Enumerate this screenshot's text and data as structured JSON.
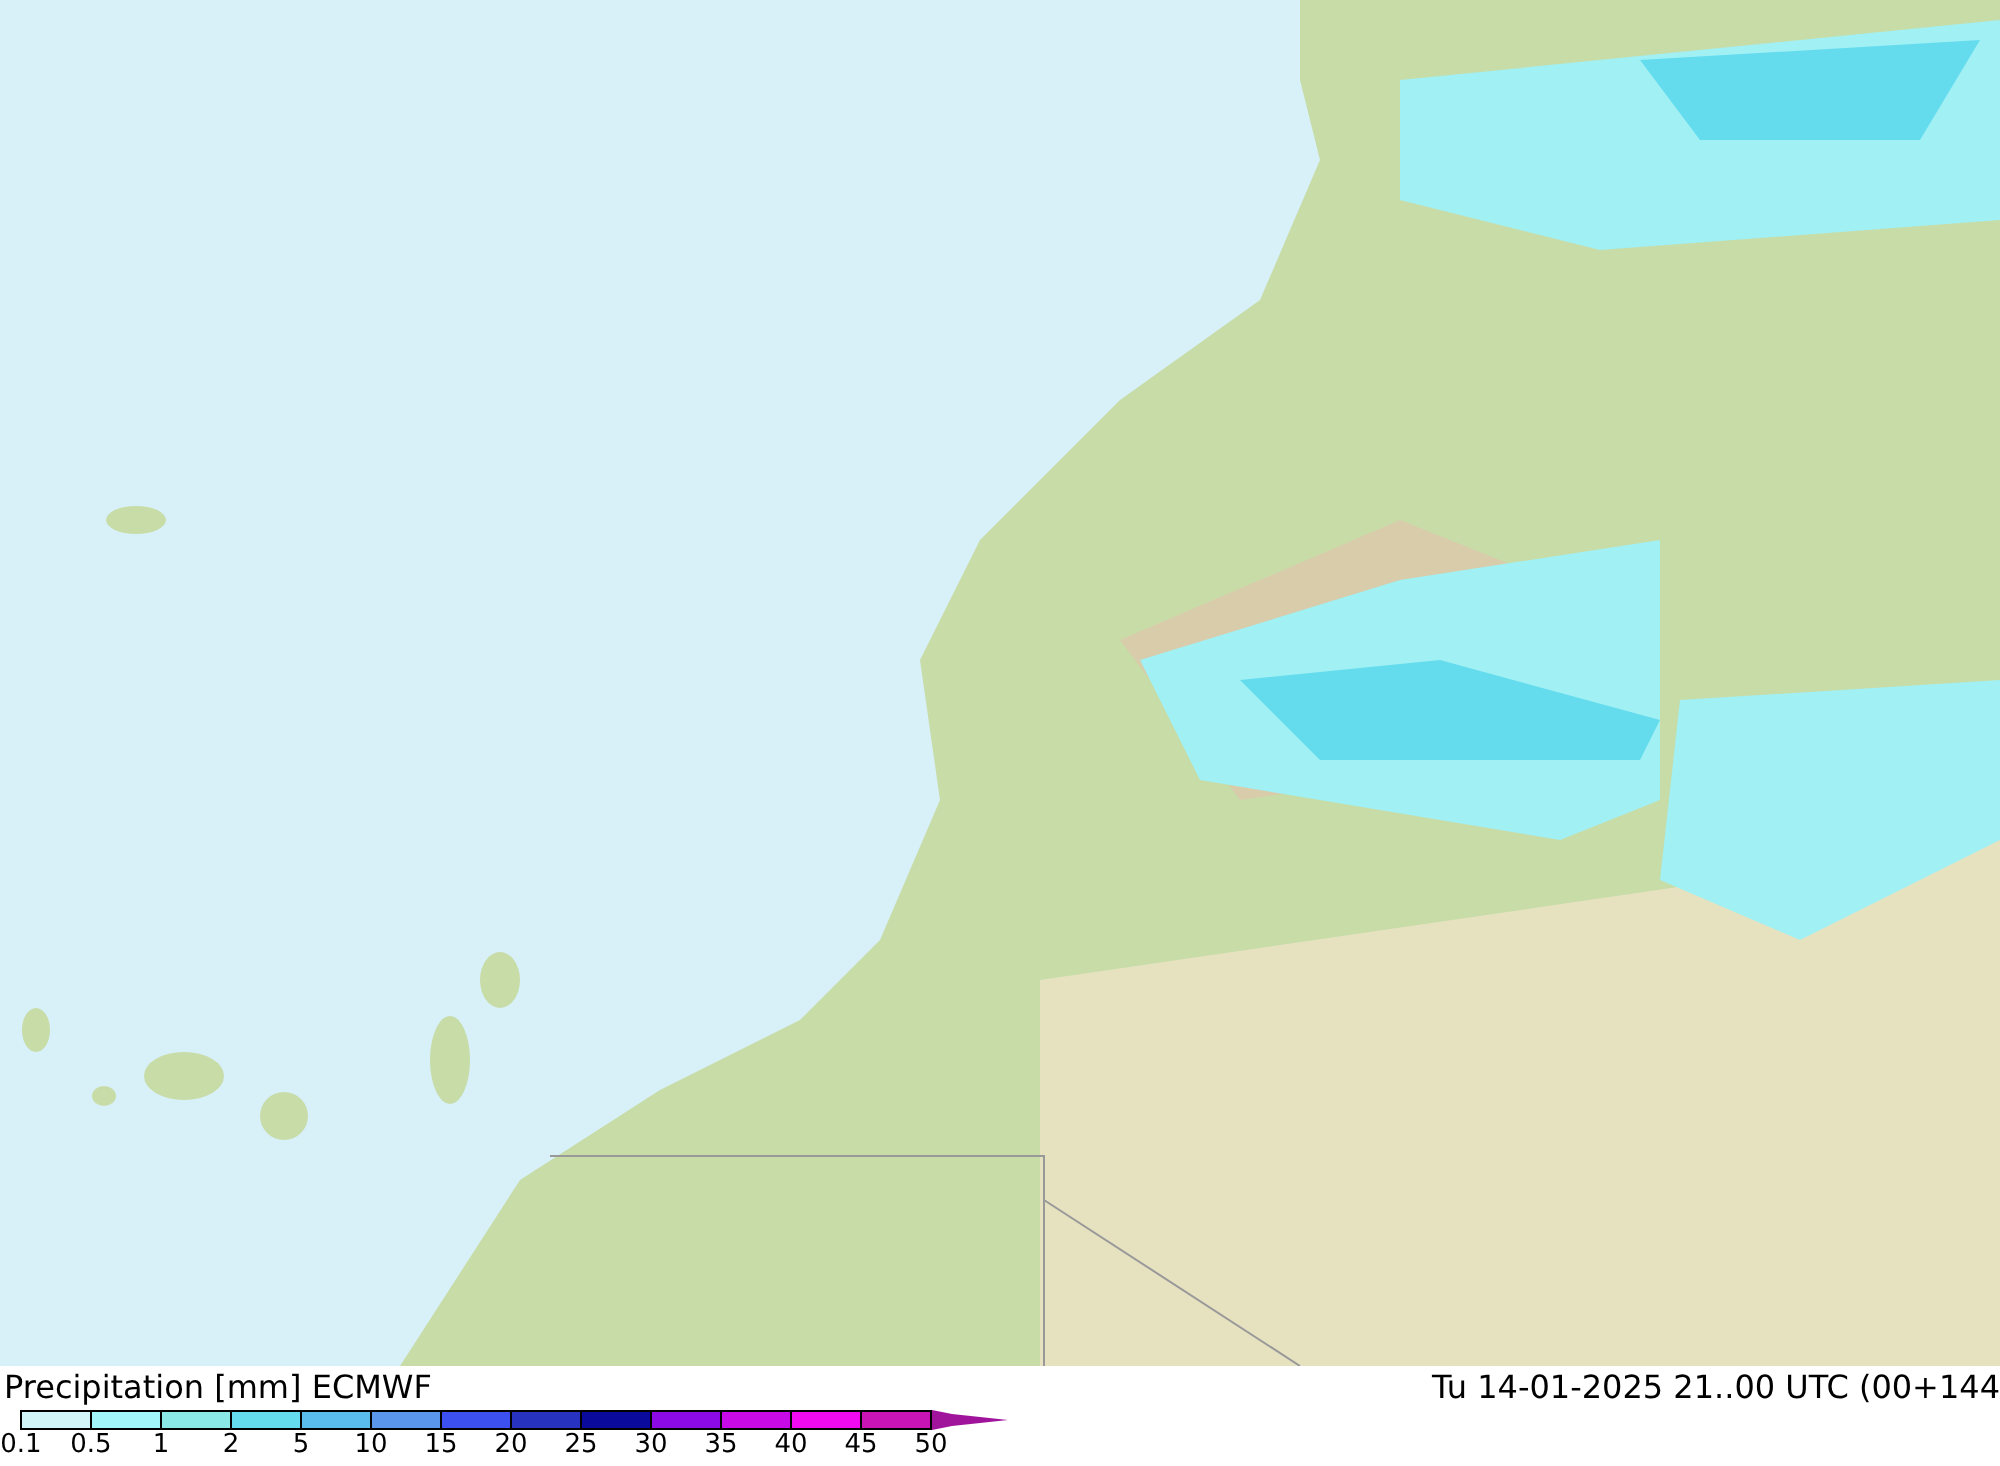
{
  "title": "Precipitation [mm] ECMWF",
  "valid_time": "Tu 14-01-2025 21..00 UTC (00+144",
  "legend": [
    {
      "label": "0.1",
      "color": "#d2f6f8"
    },
    {
      "label": "0.5",
      "color": "#a0f6f8"
    },
    {
      "label": "1",
      "color": "#8ae8e6"
    },
    {
      "label": "2",
      "color": "#64dcee"
    },
    {
      "label": "5",
      "color": "#5abcec"
    },
    {
      "label": "10",
      "color": "#5a96ec"
    },
    {
      "label": "15",
      "color": "#3c50f0"
    },
    {
      "label": "20",
      "color": "#2832c0"
    },
    {
      "label": "25",
      "color": "#0a0a9c"
    },
    {
      "label": "30",
      "color": "#8c0ae6"
    },
    {
      "label": "35",
      "color": "#c80ae6"
    },
    {
      "label": "40",
      "color": "#f00af0"
    },
    {
      "label": "45",
      "color": "#c814b4"
    },
    {
      "label": "50",
      "color": "#a0149b"
    }
  ]
}
